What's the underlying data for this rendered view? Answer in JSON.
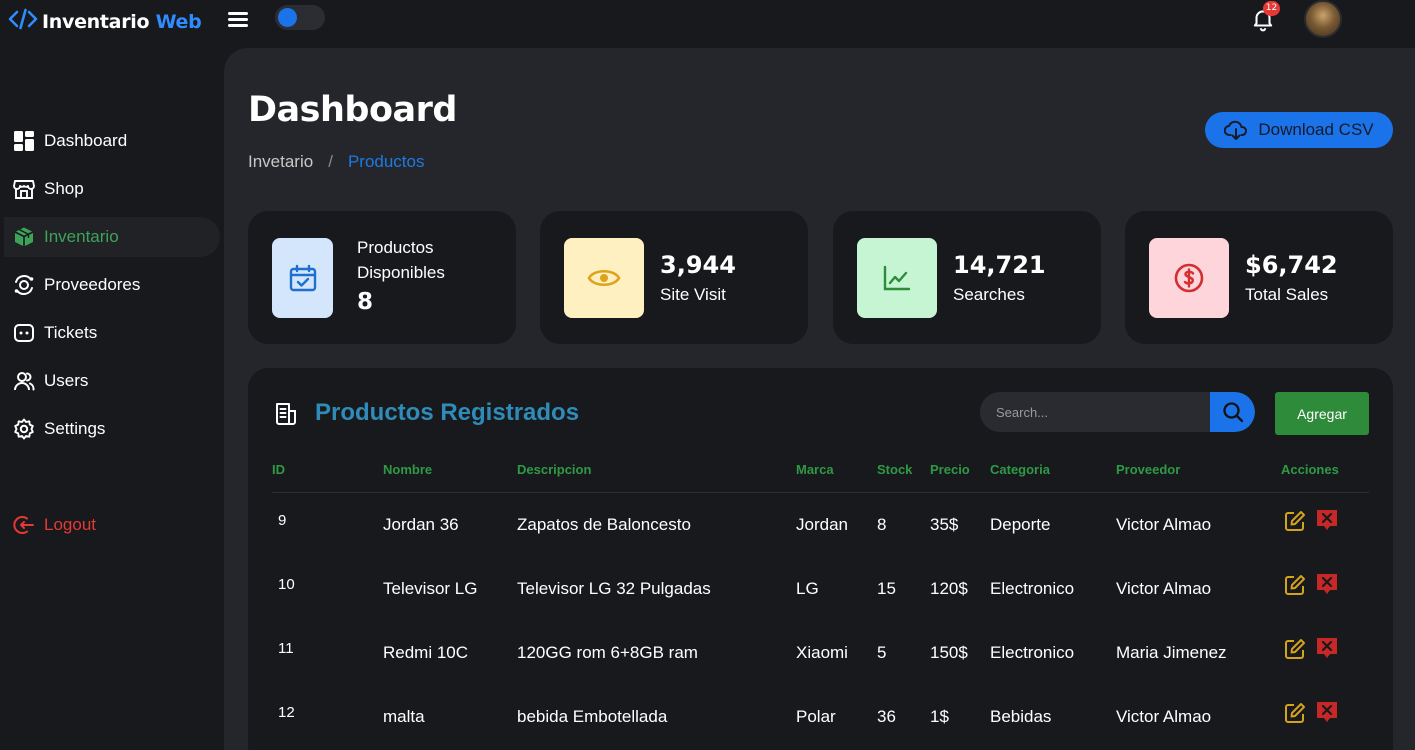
{
  "app": {
    "name": "Inventario",
    "name_accent": "Web",
    "notifications": "12"
  },
  "sidebar": {
    "items": [
      {
        "label": "Dashboard",
        "icon": "dashboard-icon"
      },
      {
        "label": "Shop",
        "icon": "shop-icon"
      },
      {
        "label": "Inventario",
        "icon": "box-icon",
        "active": true
      },
      {
        "label": "Proveedores",
        "icon": "providers-icon"
      },
      {
        "label": "Tickets",
        "icon": "ticket-icon"
      },
      {
        "label": "Users",
        "icon": "users-icon"
      },
      {
        "label": "Settings",
        "icon": "gear-icon"
      }
    ],
    "logout": "Logout"
  },
  "header": {
    "title": "Dashboard",
    "breadcrumb": [
      "Invetario",
      "Productos"
    ],
    "csv_button": "Download CSV"
  },
  "stats": [
    {
      "label": "Productos Disponibles",
      "value": "8",
      "color": "#d3e6fb",
      "icon": "calendar-check-icon"
    },
    {
      "label": "Site Visit",
      "value": "3,944",
      "color": "#fff0c2",
      "icon": "eye-icon"
    },
    {
      "label": "Searches",
      "value": "14,721",
      "color": "#c5f5d3",
      "icon": "chart-line-icon"
    },
    {
      "label": "Total Sales",
      "value": "$6,742",
      "color": "#fdd5db",
      "icon": "dollar-icon"
    }
  ],
  "products": {
    "title": "Productos Registrados",
    "search_placeholder": "Search...",
    "add_button": "Agregar",
    "columns": [
      "ID",
      "Nombre",
      "Descripcion",
      "Marca",
      "Stock",
      "Precio",
      "Categoria",
      "Proveedor",
      "Acciones"
    ],
    "rows": [
      [
        "9",
        "Jordan 36",
        "Zapatos de Baloncesto",
        "Jordan",
        "8",
        "35$",
        "Deporte",
        "Victor Almao"
      ],
      [
        "10",
        "Televisor LG",
        "Televisor LG 32 Pulgadas",
        "LG",
        "15",
        "120$",
        "Electronico",
        "Victor Almao"
      ],
      [
        "11",
        "Redmi 10C",
        "120GG rom 6+8GB ram",
        "Xiaomi",
        "5",
        "150$",
        "Electronico",
        "Maria Jimenez"
      ],
      [
        "12",
        "malta",
        "bebida Embotellada",
        "Polar",
        "36",
        "1$",
        "Bebidas",
        "Victor Almao"
      ]
    ]
  }
}
